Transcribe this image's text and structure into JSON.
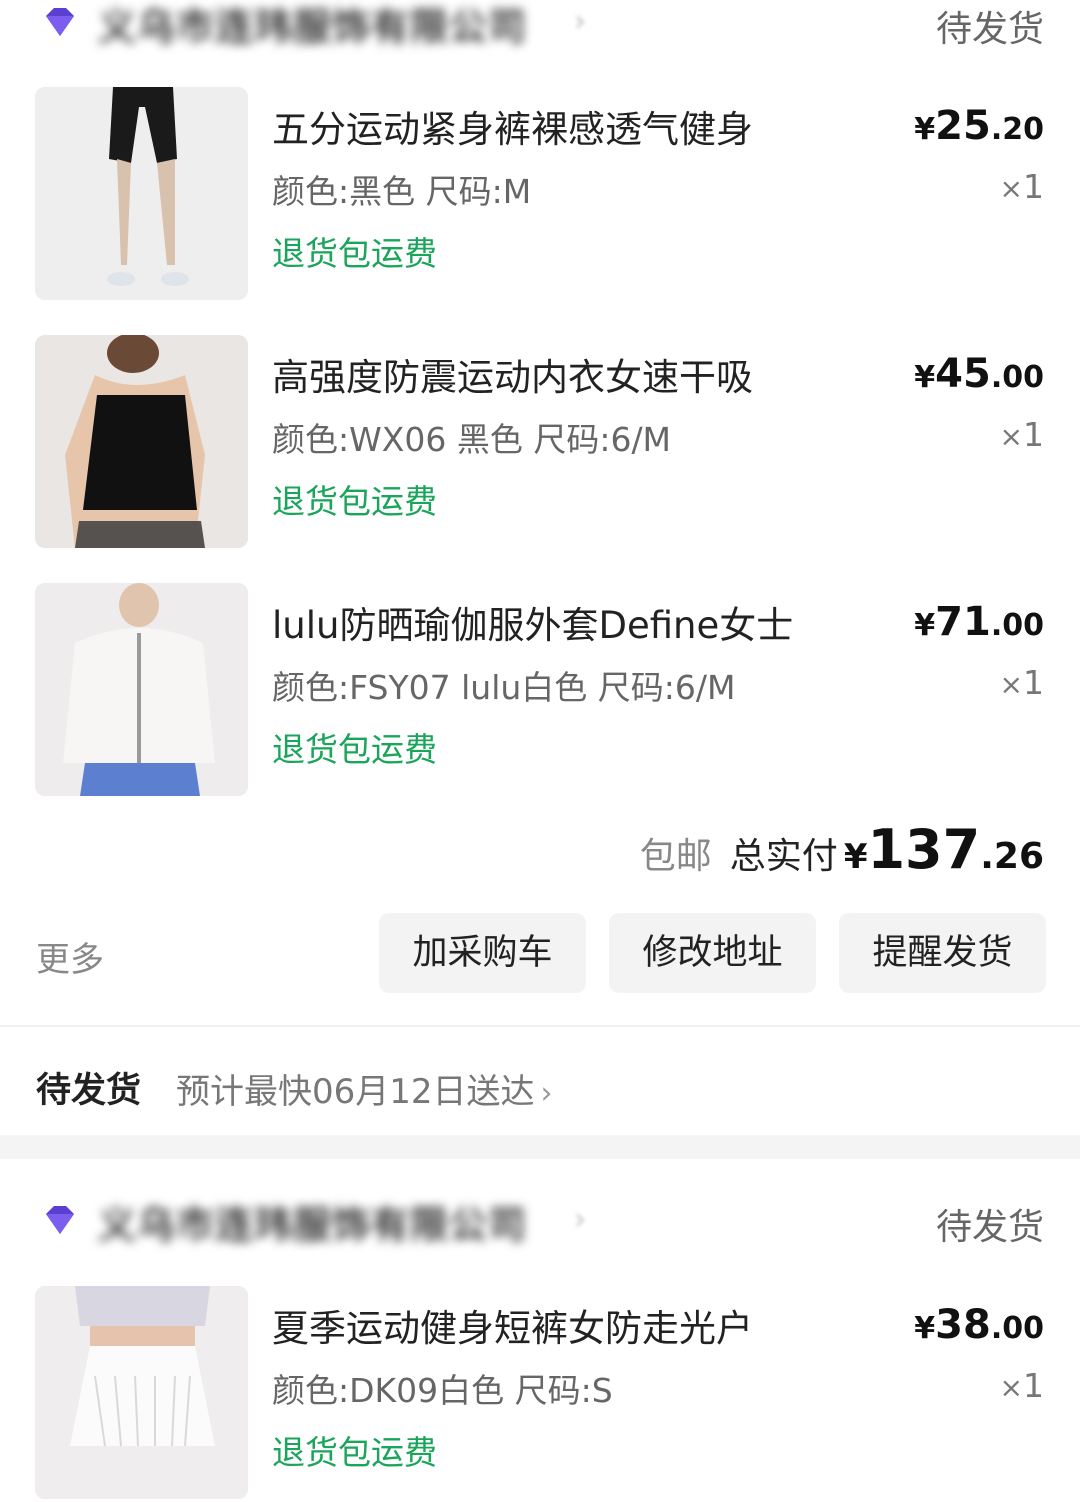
{
  "order1": {
    "shop": {
      "name": "义乌市连玮服饰有限公司",
      "chevron": "›",
      "status": "待发货"
    },
    "items": [
      {
        "title": "五分运动紧身裤裸感透气健身",
        "spec": "颜色:黑色 尺码:M",
        "tag": "退货包运费",
        "price": {
          "cur": "¥",
          "int": "25",
          "dec": ".20"
        },
        "qty": {
          "x": "×",
          "n": "1"
        }
      },
      {
        "title": "高强度防震运动内衣女速干吸",
        "spec": "颜色:WX06 黑色 尺码:6/M",
        "tag": "退货包运费",
        "price": {
          "cur": "¥",
          "int": "45",
          "dec": ".00"
        },
        "qty": {
          "x": "×",
          "n": "1"
        }
      },
      {
        "title": "lulu防晒瑜伽服外套Define女士",
        "spec": "颜色:FSY07 lulu白色 尺码:6/M",
        "tag": "退货包运费",
        "price": {
          "cur": "¥",
          "int": "71",
          "dec": ".00"
        },
        "qty": {
          "x": "×",
          "n": "1"
        }
      }
    ],
    "total": {
      "shipping": "包邮",
      "label": "总实付",
      "cur": "¥",
      "int": "137",
      "dec": ".26"
    },
    "actions": {
      "more": "更多",
      "add_cart": "加采购车",
      "edit_address": "修改地址",
      "remind_ship": "提醒发货"
    },
    "delivery": {
      "status": "待发货",
      "eta": "预计最快06月12日送达",
      "chevron": "›"
    }
  },
  "order2": {
    "shop": {
      "name": "义乌市连玮服饰有限公司",
      "chevron": "›",
      "status": "待发货"
    },
    "items": [
      {
        "title": "夏季运动健身短裤女防走光户",
        "spec": "颜色:DK09白色 尺码:S",
        "tag": "退货包运费",
        "price": {
          "cur": "¥",
          "int": "38",
          "dec": ".00"
        },
        "qty": {
          "x": "×",
          "n": "1"
        }
      }
    ]
  },
  "colors": {
    "green_tag": "#1aa55a",
    "gem": "#5b3fd0",
    "button_bg": "#f3f3f3"
  },
  "icons": {
    "shop_badge": "diamond-icon",
    "chevron": "chevron-right-icon"
  }
}
